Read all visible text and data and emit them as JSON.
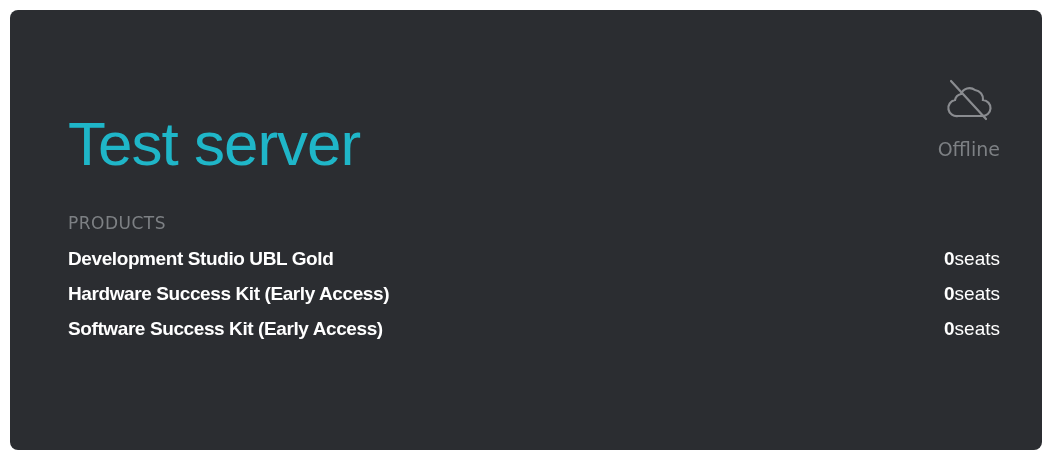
{
  "server": {
    "title": "Test server",
    "status": {
      "label": "Offline",
      "online": false
    }
  },
  "products": {
    "heading": "PRODUCTS",
    "items": [
      {
        "name": "Development Studio UBL Gold",
        "seats": "**0**seats"
      },
      {
        "name": "Hardware Success Kit (Early Access)",
        "seats": "**0**seats"
      },
      {
        "name": "Software Success Kit (Early Access)",
        "seats": "**0**seats"
      }
    ]
  }
}
